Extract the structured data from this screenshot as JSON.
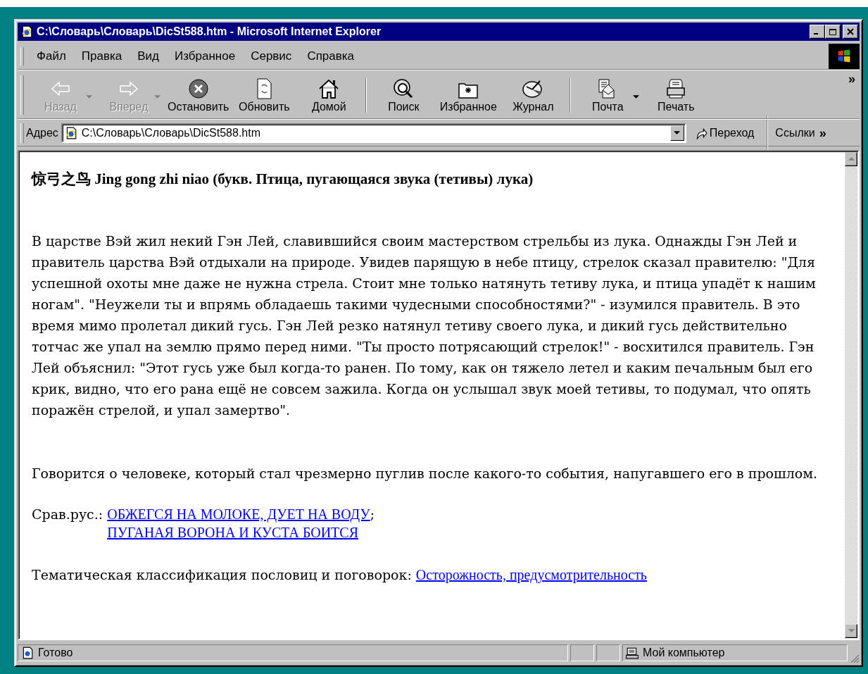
{
  "window": {
    "title": "C:\\Словарь\\Словарь\\DicSt588.htm - Microsoft Internet Explorer"
  },
  "menu": [
    {
      "label": "Файл"
    },
    {
      "label": "Правка"
    },
    {
      "label": "Вид"
    },
    {
      "label": "Избранное"
    },
    {
      "label": "Сервис"
    },
    {
      "label": "Справка"
    }
  ],
  "toolbar_groups": [
    [
      {
        "label": "Назад",
        "kind": "back",
        "disabled": true,
        "dropdown": true
      },
      {
        "label": "Вперед",
        "kind": "forward",
        "disabled": true,
        "dropdown": true
      },
      {
        "label": "Остановить",
        "kind": "stop",
        "disabled": false,
        "dropdown": false
      },
      {
        "label": "Обновить",
        "kind": "refresh",
        "disabled": false,
        "dropdown": false
      },
      {
        "label": "Домой",
        "kind": "home",
        "disabled": false,
        "dropdown": false
      }
    ],
    [
      {
        "label": "Поиск",
        "kind": "search",
        "disabled": false,
        "dropdown": false
      },
      {
        "label": "Избранное",
        "kind": "favorites",
        "disabled": false,
        "dropdown": false
      },
      {
        "label": "Журнал",
        "kind": "history",
        "disabled": false,
        "dropdown": false
      }
    ],
    [
      {
        "label": "Почта",
        "kind": "mail",
        "disabled": false,
        "dropdown": true
      },
      {
        "label": "Печать",
        "kind": "print",
        "disabled": false,
        "dropdown": false
      }
    ]
  ],
  "toolbar_more": "»",
  "address_bar": {
    "label": "Адрес",
    "value": "C:\\Словарь\\Словарь\\DicSt588.htm",
    "go": "Переход",
    "links": "Ссылки",
    "links_more": "»"
  },
  "content": {
    "heading": "惊弓之鸟 Jing gong zhi niao (букв. Птица, пугающаяся звука (тетивы) лука)",
    "paragraphs": [
      "В царстве Вэй жил некий Гэн Лей, славившийся своим мастерством стрельбы из лука. Однажды Гэн Лей и правитель царства Вэй отдыхали на природе. Увидев парящую в небе птицу, стрелок сказал правителю: \"Для успешной охоты мне даже не нужна стрела. Стоит мне только натянуть тетиву лука, и птица упадёт к нашим ногам\". \"Неужели ты и впрямь обладаешь такими чудесными способностями?\" - изумился правитель. В это время мимо пролетал дикий гусь. Гэн Лей резко натянул тетиву своего лука, и дикий гусь действительно тотчас же упал на землю прямо перед ними. \"Ты просто потрясающий стрелок!\" - восхитился правитель. Гэн Лей объяснил: \"Этот гусь уже был когда-то ранен. По тому, как он тяжело летел и каким печальным был его крик, видно, что его рана ещё не совсем зажила. Когда он услышал звук моей тетивы, то подумал, что опять поражён стрелой, и упал замертво\".",
      "Говорится о человеке, который стал чрезмерно пуглив после какого-то события, напугавшего его в прошлом."
    ],
    "compare": {
      "label": "Срав.рус.:",
      "links": [
        "ОБЖЕГСЯ НА МОЛОКЕ, ДУЕТ НА ВОДУ",
        "ПУГАНАЯ ВОРОНА И КУСТА БОИТСЯ"
      ],
      "separator": ";"
    },
    "theme": {
      "label": "Тематическая классификация пословиц и поговорок:",
      "link": "Осторожность, предусмотрительность"
    }
  },
  "status_bar": {
    "text": "Готово",
    "zone": "Мой компьютер"
  }
}
